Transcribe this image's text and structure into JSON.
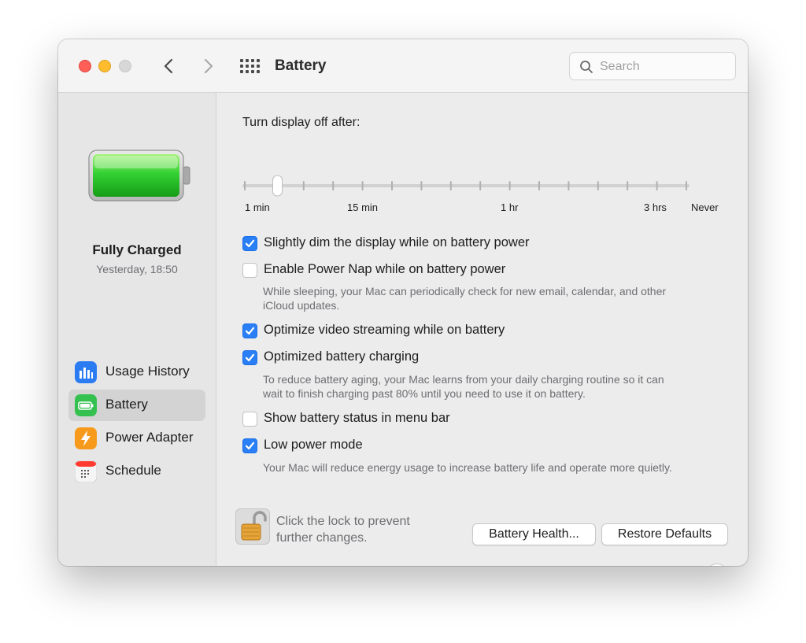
{
  "window": {
    "title": "Battery",
    "search_placeholder": "Search"
  },
  "sidebar": {
    "status_title": "Fully Charged",
    "status_time": "Yesterday, 18:50",
    "items": [
      {
        "label": "Usage History",
        "icon": "bar-chart-icon",
        "color": "#2b7cf2"
      },
      {
        "label": "Battery",
        "icon": "battery-icon",
        "color": "#35c14f",
        "selected": true
      },
      {
        "label": "Power Adapter",
        "icon": "lightning-icon",
        "color": "#f79a1c"
      },
      {
        "label": "Schedule",
        "icon": "calendar-icon",
        "color": "#ff3b30"
      }
    ]
  },
  "display_off": {
    "label": "Turn display off after:",
    "tick_labels": [
      "1 min",
      "15 min",
      "1 hr",
      "3 hrs",
      "Never"
    ],
    "slider_position": 0.074
  },
  "options": [
    {
      "label": "Slightly dim the display while on battery power",
      "checked": true,
      "description": ""
    },
    {
      "label": "Enable Power Nap while on battery power",
      "checked": false,
      "description_lines": [
        "While sleeping, your Mac can periodically check for new email, calendar, and other",
        "iCloud updates."
      ]
    },
    {
      "label": "Optimize video streaming while on battery",
      "checked": true
    },
    {
      "label": "Optimized battery charging",
      "checked": true,
      "description_lines": [
        "To reduce battery aging, your Mac learns from your daily charging routine so it can",
        "wait to finish charging past 80% until you need to use it on battery."
      ]
    },
    {
      "label": "Show battery status in menu bar",
      "checked": false
    },
    {
      "label": "Low power mode",
      "checked": true,
      "description_lines": [
        "Your Mac will reduce energy usage to increase battery life and operate more quietly."
      ]
    }
  ],
  "buttons": {
    "battery_health": "Battery Health...",
    "restore_defaults": "Restore Defaults",
    "help": "?"
  },
  "lock": {
    "line1": "Click the lock to prevent",
    "line2": "further changes."
  },
  "colors": {
    "accent": "#2a7ff6",
    "battery_green": "#2fd12f"
  }
}
